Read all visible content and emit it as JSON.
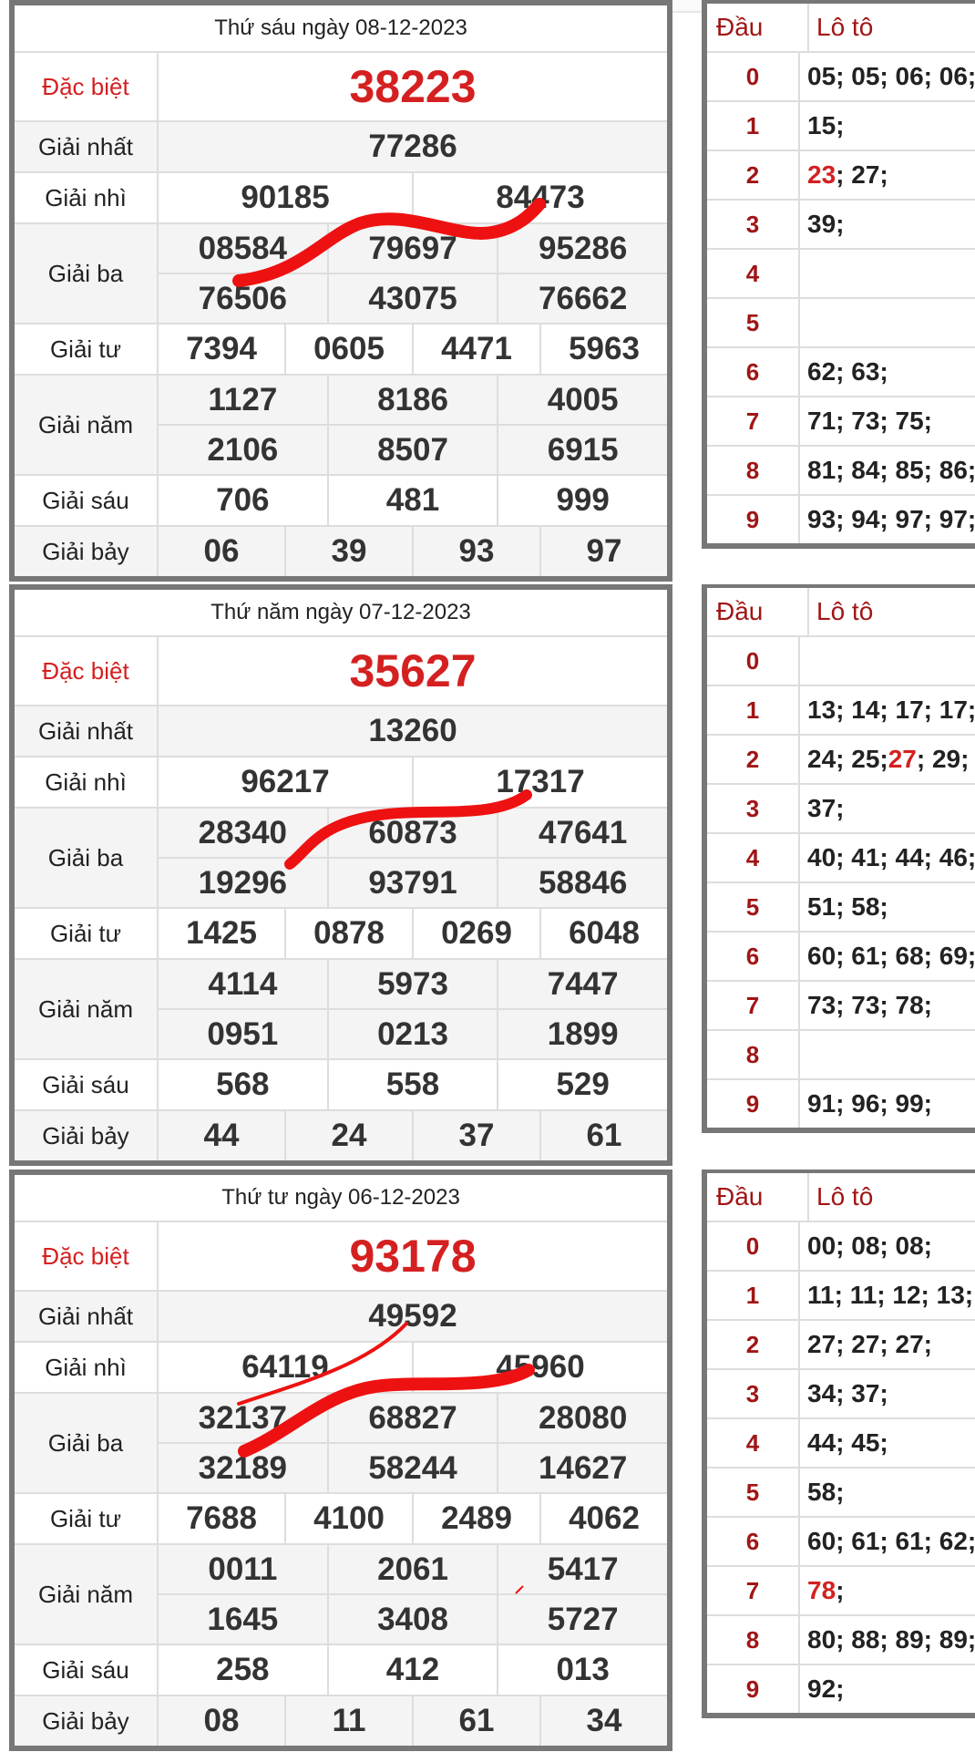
{
  "headers": {
    "dau": "Đầu",
    "loto": "Lô tô"
  },
  "labels": {
    "special": "Đặc biệt",
    "first": "Giải nhất",
    "second": "Giải nhì",
    "third": "Giải ba",
    "fourth": "Giải tư",
    "fifth": "Giải năm",
    "sixth": "Giải sáu",
    "seventh": "Giải bảy"
  },
  "colors": {
    "special": "#d42020",
    "head": "#a01515",
    "border": "#777777",
    "scribble": "#ee1111"
  },
  "days": [
    {
      "title": "Thứ sáu ngày 08-12-2023",
      "special": "38223",
      "first": "77286",
      "second": [
        "90185",
        "84473"
      ],
      "third": [
        [
          "08584",
          "79697",
          "95286"
        ],
        [
          "76506",
          "43075",
          "76662"
        ]
      ],
      "fourth": [
        "7394",
        "0605",
        "4471",
        "5963"
      ],
      "fifth": [
        [
          "1127",
          "8186",
          "4005"
        ],
        [
          "2106",
          "8507",
          "6915"
        ]
      ],
      "sixth": [
        "706",
        "481",
        "999"
      ],
      "seventh": [
        "06",
        "39",
        "93",
        "97"
      ],
      "loto": [
        [
          "0",
          "05; 05; 06; 06;"
        ],
        [
          "1",
          "15;"
        ],
        [
          "2",
          "23",
          "; 27;"
        ],
        [
          "3",
          "39;"
        ],
        [
          "4",
          ""
        ],
        [
          "5",
          ""
        ],
        [
          "6",
          "62; 63;"
        ],
        [
          "7",
          "71; 73; 75;"
        ],
        [
          "8",
          "81; 84; 85; 86;"
        ],
        [
          "9",
          "93; 94; 97; 97;"
        ]
      ]
    },
    {
      "title": "Thứ năm ngày 07-12-2023",
      "special": "35627",
      "first": "13260",
      "second": [
        "96217",
        "17317"
      ],
      "third": [
        [
          "28340",
          "60873",
          "47641"
        ],
        [
          "19296",
          "93791",
          "58846"
        ]
      ],
      "fourth": [
        "1425",
        "0878",
        "0269",
        "6048"
      ],
      "fifth": [
        [
          "4114",
          "5973",
          "7447"
        ],
        [
          "0951",
          "0213",
          "1899"
        ]
      ],
      "sixth": [
        "568",
        "558",
        "529"
      ],
      "seventh": [
        "44",
        "24",
        "37",
        "61"
      ],
      "loto": [
        [
          "0",
          ""
        ],
        [
          "1",
          "13; 14; 17; 17;"
        ],
        [
          "2",
          "24; 25; ",
          "27",
          "; 29;"
        ],
        [
          "3",
          "37;"
        ],
        [
          "4",
          "40; 41; 44; 46;"
        ],
        [
          "5",
          "51; 58;"
        ],
        [
          "6",
          "60; 61; 68; 69;"
        ],
        [
          "7",
          "73; 73; 78;"
        ],
        [
          "8",
          ""
        ],
        [
          "9",
          "91; 96; 99;"
        ]
      ]
    },
    {
      "title": "Thứ tư ngày 06-12-2023",
      "special": "93178",
      "first": "49592",
      "second": [
        "64119",
        "45960"
      ],
      "third": [
        [
          "32137",
          "68827",
          "28080"
        ],
        [
          "32189",
          "58244",
          "14627"
        ]
      ],
      "fourth": [
        "7688",
        "4100",
        "2489",
        "4062"
      ],
      "fifth": [
        [
          "0011",
          "2061",
          "5417"
        ],
        [
          "1645",
          "3408",
          "5727"
        ]
      ],
      "sixth": [
        "258",
        "412",
        "013"
      ],
      "seventh": [
        "08",
        "11",
        "61",
        "34"
      ],
      "loto": [
        [
          "0",
          "00; 08; 08;"
        ],
        [
          "1",
          "11; 11; 12; 13;"
        ],
        [
          "2",
          "27; 27; 27;"
        ],
        [
          "3",
          "34; 37;"
        ],
        [
          "4",
          "44; 45;"
        ],
        [
          "5",
          "58;"
        ],
        [
          "6",
          "60; 61; 61; 62;"
        ],
        [
          "7",
          "",
          "78",
          ";"
        ],
        [
          "8",
          "80; 88; 89; 89;"
        ],
        [
          "9",
          "92;"
        ]
      ]
    }
  ]
}
